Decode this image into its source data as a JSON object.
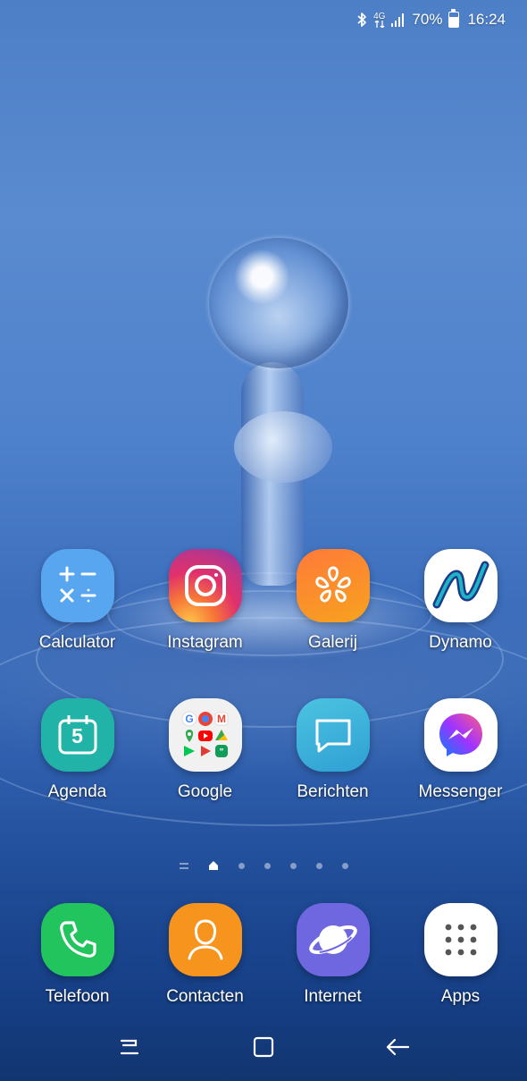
{
  "status_bar": {
    "network": "4G",
    "battery_percent": "70%",
    "time": "16:24",
    "icons": [
      "bluetooth-icon",
      "network-4g-icon",
      "signal-icon",
      "battery-icon"
    ]
  },
  "home": {
    "rows": [
      [
        {
          "name": "calculator",
          "label": "Calculator",
          "icon": "calculator-icon",
          "color": "#58a6ef"
        },
        {
          "name": "instagram",
          "label": "Instagram",
          "icon": "instagram-icon",
          "color": "#d62976"
        },
        {
          "name": "galerij",
          "label": "Galerij",
          "icon": "gallery-flower-icon",
          "color": "#f7931e"
        },
        {
          "name": "dynamo",
          "label": "Dynamo",
          "icon": "dynamo-icon",
          "color": "#ffffff"
        }
      ],
      [
        {
          "name": "agenda",
          "label": "Agenda",
          "icon": "calendar-icon",
          "calendar_day": "5",
          "color": "#22b3a8"
        },
        {
          "name": "google",
          "label": "Google",
          "icon": "google-folder-icon",
          "color": "#f1f1f1"
        },
        {
          "name": "berichten",
          "label": "Berichten",
          "icon": "message-bubble-icon",
          "color": "#3fb1d8"
        },
        {
          "name": "messenger",
          "label": "Messenger",
          "icon": "messenger-icon",
          "color": "#ffffff"
        }
      ]
    ],
    "active_page_index": 1,
    "page_count": 7
  },
  "dock": [
    {
      "name": "telefoon",
      "label": "Telefoon",
      "icon": "phone-icon",
      "color": "#22c45e"
    },
    {
      "name": "contacten",
      "label": "Contacten",
      "icon": "contacts-person-icon",
      "color": "#f7941d"
    },
    {
      "name": "internet",
      "label": "Internet",
      "icon": "internet-planet-icon",
      "color": "#6f67e0"
    },
    {
      "name": "apps",
      "label": "Apps",
      "icon": "apps-grid-icon",
      "color": "#ffffff"
    }
  ],
  "nav": {
    "buttons": [
      "recents-icon",
      "home-button-icon",
      "back-arrow-icon"
    ]
  }
}
